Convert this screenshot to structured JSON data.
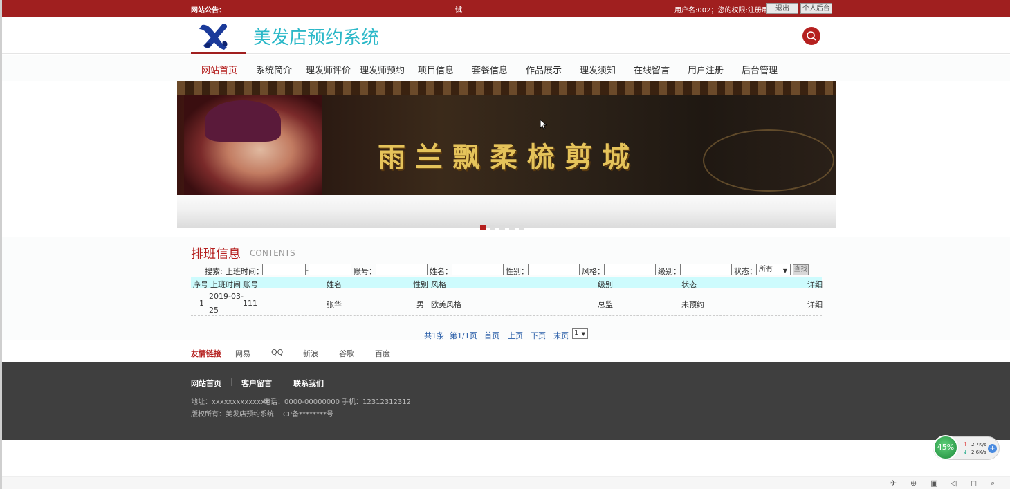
{
  "topbar": {
    "notice_label": "网站公告：",
    "marquee": "试",
    "user_info": "用户名:002；您的权限:注册用户",
    "logout_label": "退出",
    "admin_label": "个人后台"
  },
  "header": {
    "site_title": "美发店预约系统",
    "search_icon": "search-icon"
  },
  "nav": {
    "items": [
      "网站首页",
      "系统简介",
      "理发师评价",
      "理发师预约",
      "项目信息",
      "套餐信息",
      "作品展示",
      "理发须知",
      "在线留言",
      "用户注册",
      "后台管理"
    ],
    "active_index": 0
  },
  "banner": {
    "title": "雨兰飘柔梳剪城",
    "slide_count": 5,
    "active_slide": 0
  },
  "section": {
    "title": "排班信息",
    "subtitle": "CONTENTS"
  },
  "search": {
    "label": "搜索:",
    "shift_time_label": "上班时间：",
    "range_sep": "-",
    "account_label": "账号：",
    "name_label": "姓名：",
    "gender_label": "性别：",
    "style_label": "风格：",
    "level_label": "级别：",
    "status_label": "状态：",
    "status_selected": "所有",
    "find_label": "查找"
  },
  "table": {
    "headers": [
      "序号",
      "上班时间",
      "账号",
      "姓名",
      "性别",
      "风格",
      "级别",
      "状态",
      "详细"
    ],
    "rows": [
      {
        "no": "1",
        "date_line1": "2019-03-",
        "date_line2": "25",
        "account": "111",
        "name": "张华",
        "gender": "男",
        "style": "欧美风格",
        "level": "总监",
        "status": "未预约",
        "detail": "详细"
      }
    ]
  },
  "pager": {
    "total": "共1条",
    "page_info": "第1/1页",
    "first": "首页",
    "prev": "上页",
    "next": "下页",
    "last": "末页",
    "selected": "1"
  },
  "friends": {
    "title": "友情链接",
    "links": [
      "网易",
      "QQ",
      "新浪",
      "谷歌",
      "百度"
    ]
  },
  "footer": {
    "links": [
      "网站首页",
      "客户留言",
      "联系我们"
    ],
    "address": "地址：xxxxxxxxxxxxxx",
    "phone": "电话：0000-00000000",
    "mobile": "手机：12312312312",
    "copyright": "版权所有：美发店预约系统",
    "icp": "ICP备********号"
  },
  "net_widget": {
    "percent": "45%",
    "up_speed": "2.7K/s",
    "down_speed": "2.6K/s"
  },
  "colors": {
    "brand_red": "#a01f1f",
    "title_cyan": "#2bb8c8",
    "table_head_bg": "#cdfbfd",
    "footer_bg": "#3f3f3f",
    "link_blue": "#2a5ea8"
  }
}
